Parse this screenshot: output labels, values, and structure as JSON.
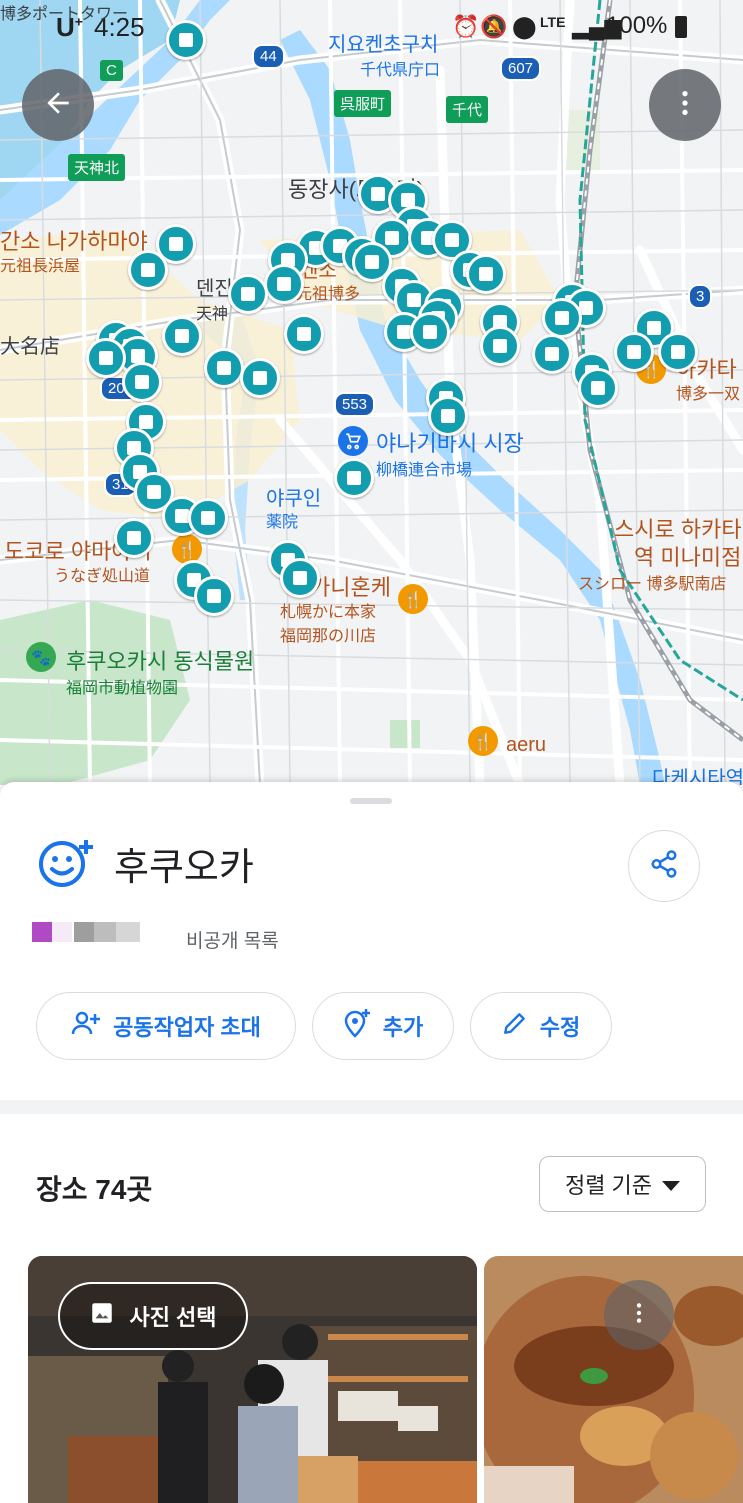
{
  "status_bar": {
    "carrier": "U",
    "carrier_sup": "+",
    "time": "4:25",
    "network": "LTE",
    "battery": "100%"
  },
  "map": {
    "labels": {
      "port_tower": "博多ポートタワー",
      "chiyo_prefectural_ko": "지요켄초구치",
      "chiyo_prefectural_ja": "千代県庁口",
      "hyogomachi": "呉服町",
      "chiyo": "千代",
      "tenjin_kita": "天神北",
      "tochoji_ko": "동장사(도초지)",
      "nagahama_ko": "간소 나가하마야",
      "nagahama_ja": "元祖長浜屋",
      "tenjin_ko": "덴진",
      "tenjin_ja": "天神",
      "ganso_hakata_ja": "元祖博多",
      "ganso_hakata_ko": "겐소",
      "daimyo": "大名店",
      "yanagibashi_ko": "야나기바시 시장",
      "yanagibashi_ja": "柳橋連合市場",
      "yakuin_ko": "야쿠인",
      "yakuin_ja": "薬院",
      "yamaya_ko": "도코로 야마야시",
      "yamaya_ja": "うなぎ処山道",
      "kanihonke_ko": "가니혼케",
      "kanihonke_ja1": "札幌かに本家",
      "kanihonke_ja2": "福岡那の川店",
      "zoo_ko": "후쿠오카시 동식물원",
      "zoo_ja": "福岡市動植物園",
      "aeru": "aeru",
      "sushiro_ko1": "스시로 하카타",
      "sushiro_ko2": "역 미나미점",
      "sushiro_ja": "スシロー 博多駅南店",
      "hakata_ko": "하카타",
      "hakata_ja": "博多一双",
      "takeshita": "다케시타역",
      "route_44": "44",
      "route_607": "607",
      "route_553": "553",
      "route_3": "3",
      "route_202": "202",
      "route_31": "31",
      "sign_c": "C"
    },
    "pin_count": 74,
    "accent_color": "#129eaf"
  },
  "list": {
    "title": "후쿠오카",
    "visibility": "비공개 목록",
    "actions": {
      "invite": "공동작업자 초대",
      "add": "추가",
      "edit": "수정"
    },
    "places_count": "장소 74곳",
    "sort_label": "정렬 기준",
    "photo_select": "사진 선택"
  },
  "icons": {
    "back": "arrow-back-icon",
    "more": "more-vert-icon",
    "share": "share-icon",
    "list": "smiley-add-icon",
    "invite": "person-add-icon",
    "add": "add-place-icon",
    "edit": "pencil-icon",
    "sort": "caret-down-icon",
    "photo": "image-icon"
  }
}
